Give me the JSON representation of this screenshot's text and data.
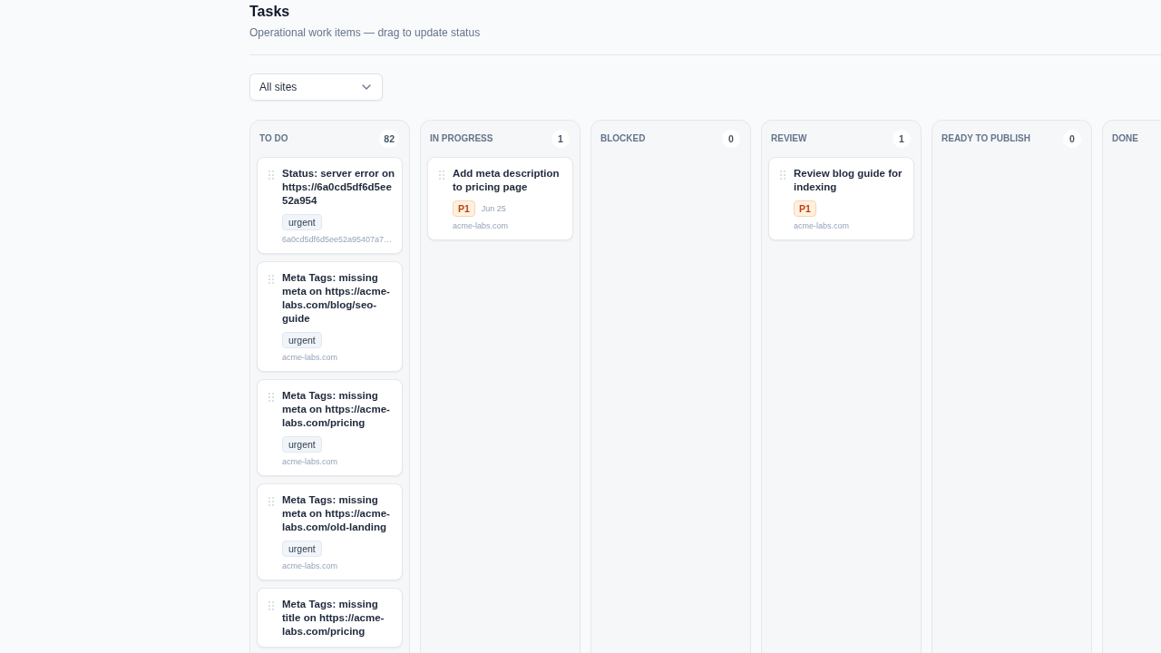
{
  "header": {
    "title": "Tasks",
    "subtitle": "Operational work items — drag to update status"
  },
  "filter": {
    "value": "All sites"
  },
  "columns": [
    {
      "title": "TO DO",
      "count": "82",
      "cards": [
        {
          "title": "Status: server error on https://6a0cd5df6d5ee52a954",
          "tags": [
            "urgent"
          ],
          "site": "6a0cd5df6d5ee52a95407a7…"
        },
        {
          "title": "Meta Tags: missing meta on https://acme-labs.com/blog/seo-guide",
          "tags": [
            "urgent"
          ],
          "site": "acme-labs.com"
        },
        {
          "title": "Meta Tags: missing meta on https://acme-labs.com/pricing",
          "tags": [
            "urgent"
          ],
          "site": "acme-labs.com"
        },
        {
          "title": "Meta Tags: missing meta on https://acme-labs.com/old-landing",
          "tags": [
            "urgent"
          ],
          "site": "acme-labs.com"
        },
        {
          "title": "Meta Tags: missing title on https://acme-labs.com/pricing"
        }
      ]
    },
    {
      "title": "IN PROGRESS",
      "count": "1",
      "cards": [
        {
          "title": "Add meta description to pricing page",
          "priority": "P1",
          "due": "Jun 25",
          "site": "acme-labs.com"
        }
      ]
    },
    {
      "title": "BLOCKED",
      "count": "0"
    },
    {
      "title": "REVIEW",
      "count": "1",
      "cards": [
        {
          "title": "Review blog guide for indexing",
          "priority": "P1",
          "site": "acme-labs.com"
        }
      ]
    },
    {
      "title": "READY TO PUBLISH",
      "count": "0"
    },
    {
      "title": "DONE"
    }
  ]
}
